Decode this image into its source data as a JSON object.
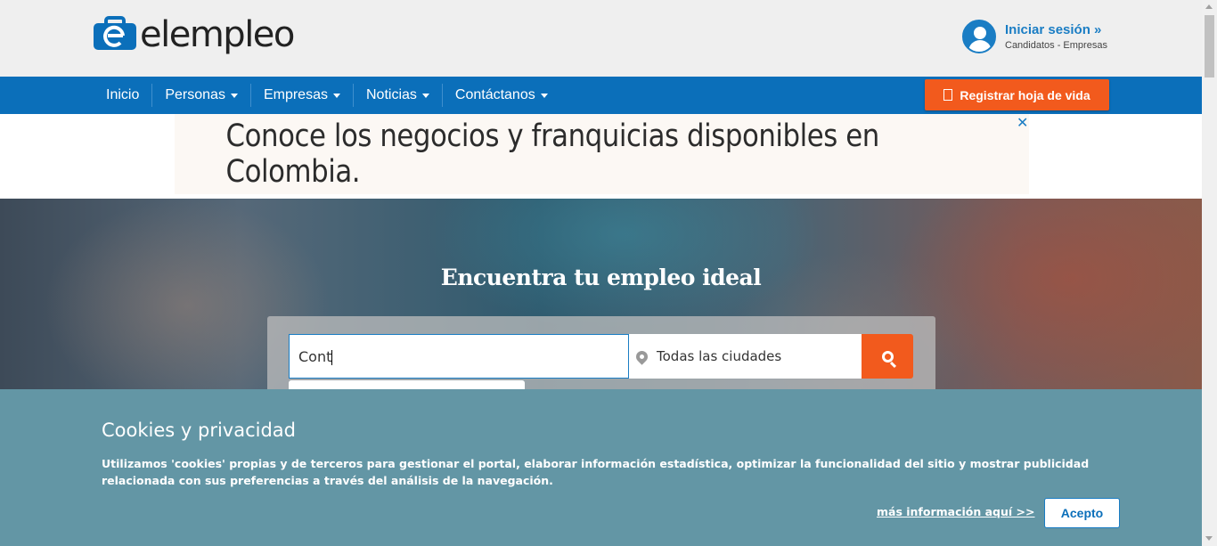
{
  "header": {
    "logo_text": "elempleo",
    "login_link": "Iniciar sesión »",
    "login_sub": "Candidatos - Empresas"
  },
  "nav": {
    "items": [
      {
        "label": "Inicio"
      },
      {
        "label": "Personas"
      },
      {
        "label": "Empresas"
      },
      {
        "label": "Noticias"
      },
      {
        "label": "Contáctanos"
      }
    ],
    "register_label": "Registrar hoja de vida"
  },
  "ad": {
    "text": "Conoce los negocios y franquicias disponibles en Colombia.",
    "close": "✕"
  },
  "hero": {
    "title": "Encuentra tu empleo ideal"
  },
  "search": {
    "query_value": "Cont",
    "city_value": "Todas las ciudades"
  },
  "cookies": {
    "title": "Cookies y privacidad",
    "text": "Utilizamos 'cookies' propias y de terceros para gestionar el portal, elaborar información estadística, optimizar la funcionalidad del sitio y mostrar publicidad relacionada con sus preferencias a través del análisis de la navegación.",
    "more_info": "más información aquí >>",
    "accept": "Acepto"
  },
  "colors": {
    "brand_blue": "#0b6fba",
    "accent_orange": "#f25a1d",
    "cookie_bg": "#6396a5"
  }
}
